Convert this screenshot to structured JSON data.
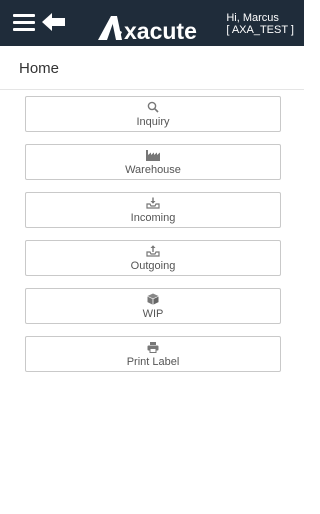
{
  "header": {
    "brand": "Axacute",
    "greeting": "Hi, Marcus",
    "site": "[ AXA_TEST ]",
    "icons": [
      "menu-icon",
      "back-arrow-icon"
    ]
  },
  "page": {
    "title": "Home"
  },
  "menu": [
    {
      "label": "Inquiry",
      "icon": "search-icon"
    },
    {
      "label": "Warehouse",
      "icon": "factory-icon"
    },
    {
      "label": "Incoming",
      "icon": "inbox-in-icon"
    },
    {
      "label": "Outgoing",
      "icon": "inbox-out-icon"
    },
    {
      "label": "WIP",
      "icon": "cube-icon"
    },
    {
      "label": "Print Label",
      "icon": "printer-icon"
    }
  ],
  "colors": {
    "header_bg": "#1f2c3a",
    "icon": "#777777",
    "border": "#c9c9c9"
  }
}
